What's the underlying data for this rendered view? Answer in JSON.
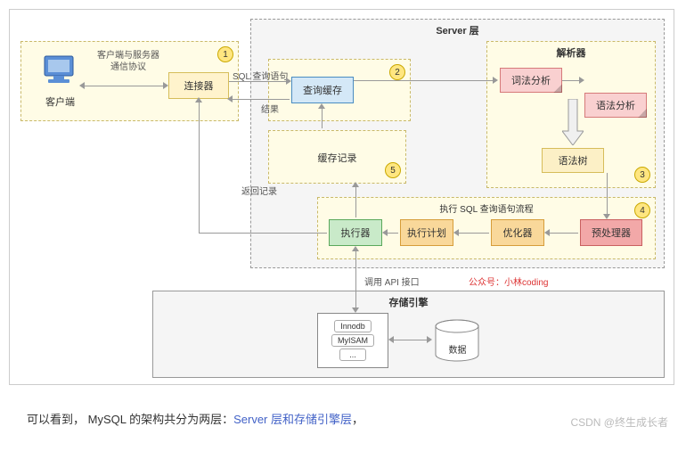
{
  "outer": {
    "server_label": "Server 层",
    "storage_label": "存储引擎"
  },
  "group1": {
    "client_label": "客户端",
    "protocol_text": "客户端与服务器\n通信协议",
    "connector_label": "连接器"
  },
  "group2": {
    "query_cache_label": "查询缓存"
  },
  "group3": {
    "parser_label": "解析器",
    "lexical_label": "词法分析",
    "syntax_label": "语法分析",
    "syntax_tree_label": "语法树"
  },
  "group4": {
    "flow_label": "执行 SQL 查询语句流程",
    "executor_label": "执行器",
    "plan_label": "执行计划",
    "optimizer_label": "优化器",
    "preprocessor_label": "预处理器"
  },
  "group5": {
    "cache_record_label": "缓存记录"
  },
  "storage": {
    "engine_innodb": "Innodb",
    "engine_myisam": "MyISAM",
    "engine_other": "...",
    "data_label": "数据"
  },
  "edges": {
    "sql_query": "SQL 查询语句",
    "result": "结果",
    "return_record": "返回记录",
    "api_call": "调用 API 接口"
  },
  "badges": {
    "b1": "1",
    "b2": "2",
    "b3": "3",
    "b4": "4",
    "b5": "5"
  },
  "credit": "公众号：小林coding",
  "caption": {
    "prefix": "可以看到，   MySQL 的架构共分为两层：",
    "highlight": "Server 层和存储引擎层",
    "suffix": "，"
  },
  "watermark": "CSDN @终生成长者"
}
